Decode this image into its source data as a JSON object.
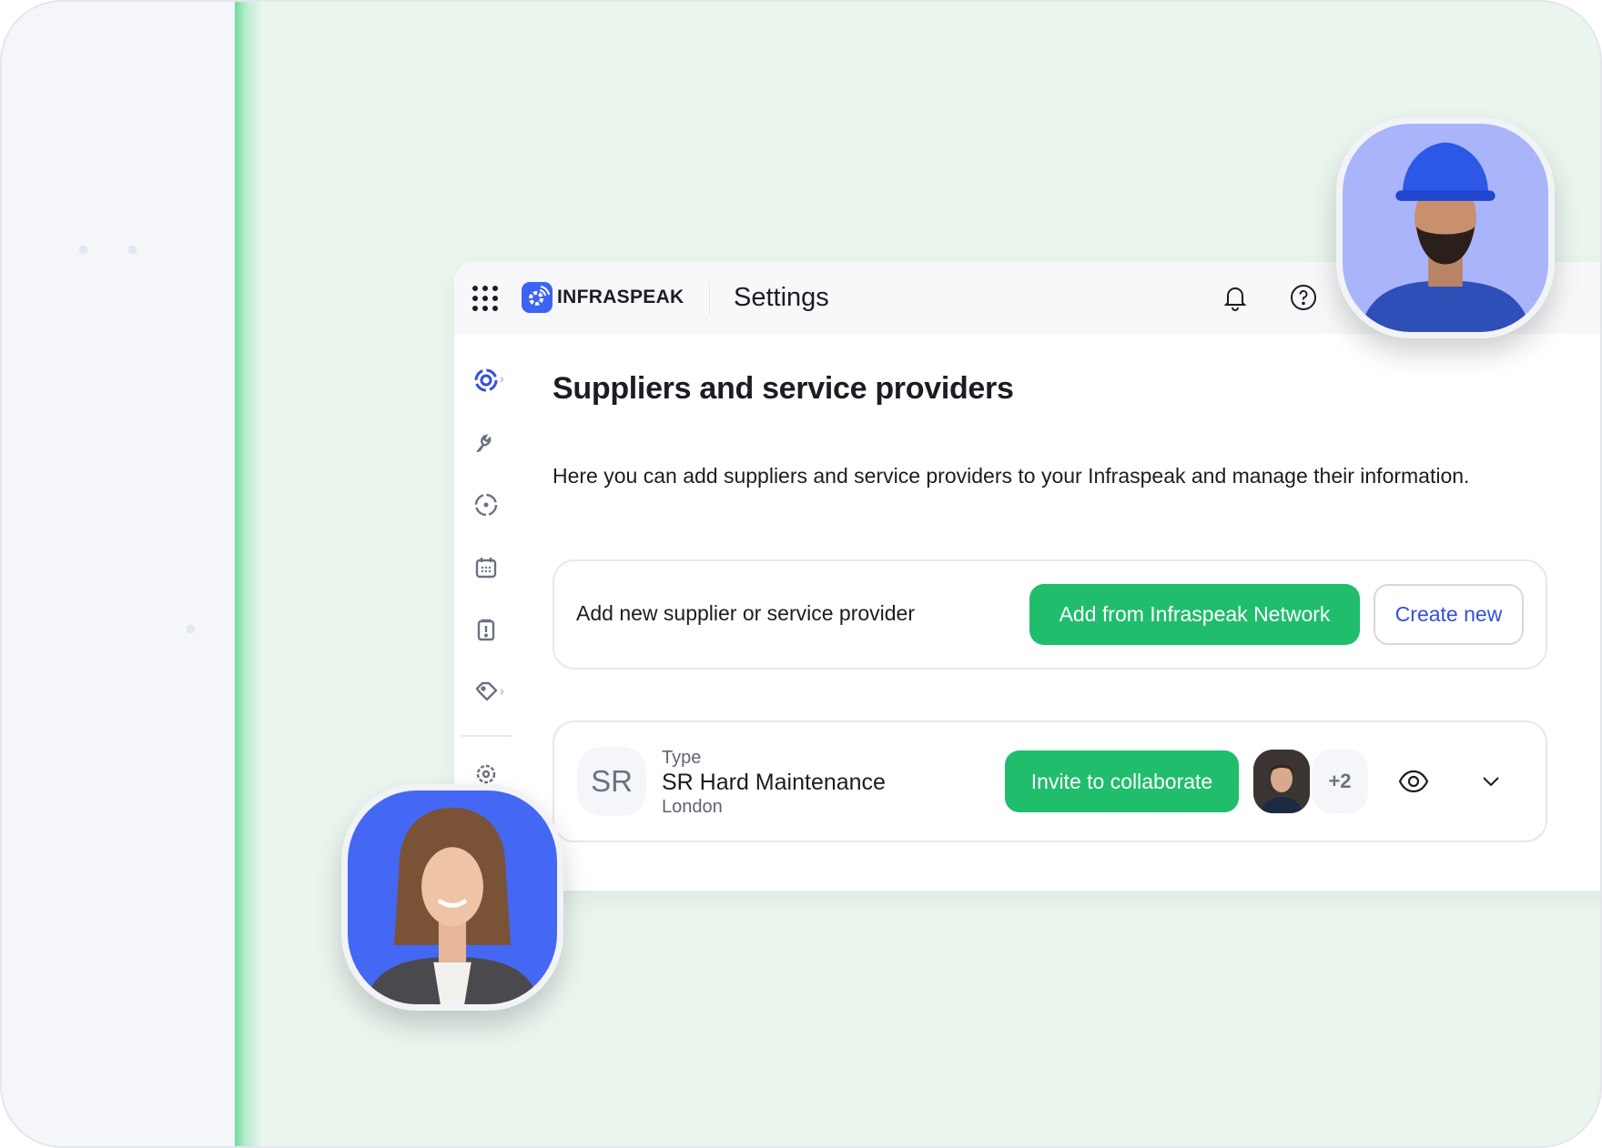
{
  "app": {
    "brand": "INFRASPEAK",
    "section": "Settings"
  },
  "header": {
    "icons": [
      "apps-grid-icon",
      "bell-icon",
      "help-icon"
    ]
  },
  "sidebar": {
    "items": [
      "dashboard-target-icon",
      "wrench-icon",
      "location-target-icon",
      "calendar-icon",
      "clipboard-alert-icon",
      "tags-icon",
      "gear-icon"
    ]
  },
  "main": {
    "title": "Suppliers and service providers",
    "description": "Here you can add suppliers and service providers to your Infraspeak and manage their information.",
    "add_box": {
      "label": "Add new supplier or service provider",
      "primary_button": "Add from Infraspeak Network",
      "secondary_button": "Create new"
    },
    "supplier": {
      "initials": "SR",
      "type_label": "Type",
      "name": "SR Hard Maintenance",
      "location": "London",
      "invite_button": "Invite to collaborate",
      "extra_collaborators": "+2"
    }
  },
  "colors": {
    "accent_green": "#1fbd6c",
    "brand_blue": "#3d63f2",
    "link_blue": "#3350d8",
    "background": "#eaf5ee"
  }
}
